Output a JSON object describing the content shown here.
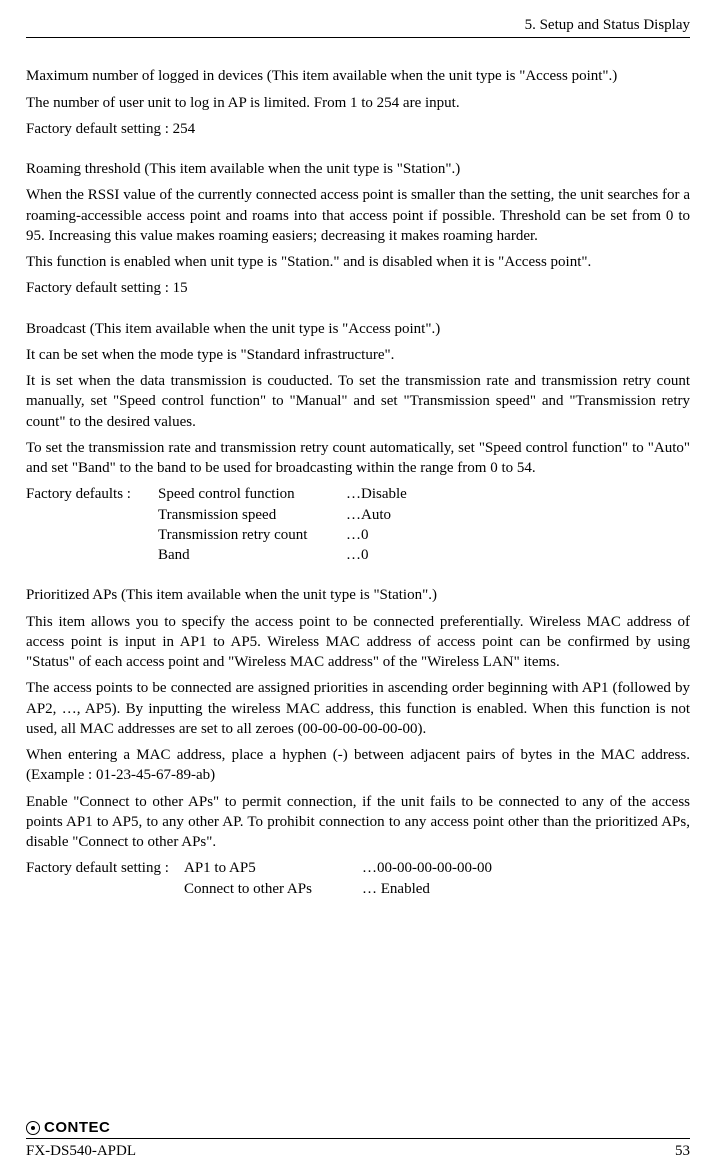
{
  "header": {
    "chapter": "5. Setup and Status Display"
  },
  "sections": {
    "maxDevices": {
      "title": "Maximum number of logged in devices (This item available when the unit type is \"Access point\".)",
      "p1": "The number of user unit to log in AP is limited.  From 1 to 254 are input.",
      "p2": "Factory default setting : 254"
    },
    "roaming": {
      "title": "Roaming threshold (This item available when the unit type is \"Station\".)",
      "p1": "When the RSSI value of the currently connected access point is smaller than the setting, the unit searches for a roaming-accessible access point and roams into that access point if possible.  Threshold can be set from 0 to 95.  Increasing this value makes roaming easiers; decreasing it makes roaming harder.",
      "p2": "This function is enabled when unit type is \"Station.\" and is disabled when it is \"Access point\".",
      "p3": "Factory default setting : 15"
    },
    "broadcast": {
      "title": "Broadcast (This item available when the unit type is \"Access point\".)",
      "p1": "It can be set when the mode type is \"Standard infrastructure\".",
      "p2": "It is set when the data transmission is couducted.  To set the transmission rate and transmission retry count manually, set \"Speed control function\" to \"Manual\" and set \"Transmission speed\" and \"Transmission retry count\" to the desired values.",
      "p3": "To set the transmission rate and transmission retry count automatically, set \"Speed control function\" to \"Auto\" and set \"Band\" to the band to be used for broadcasting within the range from 0 to 54.",
      "defaultsLead": "Factory defaults : ",
      "rows": [
        {
          "label": "Speed control function",
          "value": "…Disable"
        },
        {
          "label": "Transmission speed",
          "value": "…Auto"
        },
        {
          "label": "Transmission retry count",
          "value": "…0"
        },
        {
          "label": "Band",
          "value": "…0"
        }
      ]
    },
    "prioritized": {
      "title": "Prioritized APs (This item available when the unit type is \"Station\".)",
      "p1": "This item allows you to specify the access point to be connected preferentially.  Wireless MAC address of access point is input in AP1 to AP5.  Wireless MAC address of access point can be confirmed by using \"Status\" of each access point and \"Wireless MAC address\" of the \"Wireless LAN\" items.",
      "p2": "The access points to be connected are assigned priorities in ascending order beginning with AP1 (followed by AP2, …, AP5).  By inputting the wireless MAC address, this function is enabled.  When this function is not used, all MAC addresses are set to all zeroes (00-00-00-00-00-00).",
      "p3": "When entering a MAC address, place a hyphen (-) between adjacent pairs of bytes in the MAC address.  (Example : 01-23-45-67-89-ab)",
      "p4": "Enable \"Connect to other APs\" to permit connection, if the unit fails to be connected to any of the access points AP1 to AP5, to any other AP.  To prohibit connection to any access point other than the prioritized APs, disable \"Connect to other APs\".",
      "defaultsLead": "Factory default setting : ",
      "rows": [
        {
          "label": "AP1 to AP5",
          "value": "…00-00-00-00-00-00"
        },
        {
          "label": "Connect to other APs",
          "value": "… Enabled"
        }
      ]
    }
  },
  "footer": {
    "brand": "CONTEC",
    "model": "FX-DS540-APDL",
    "page": "53"
  }
}
